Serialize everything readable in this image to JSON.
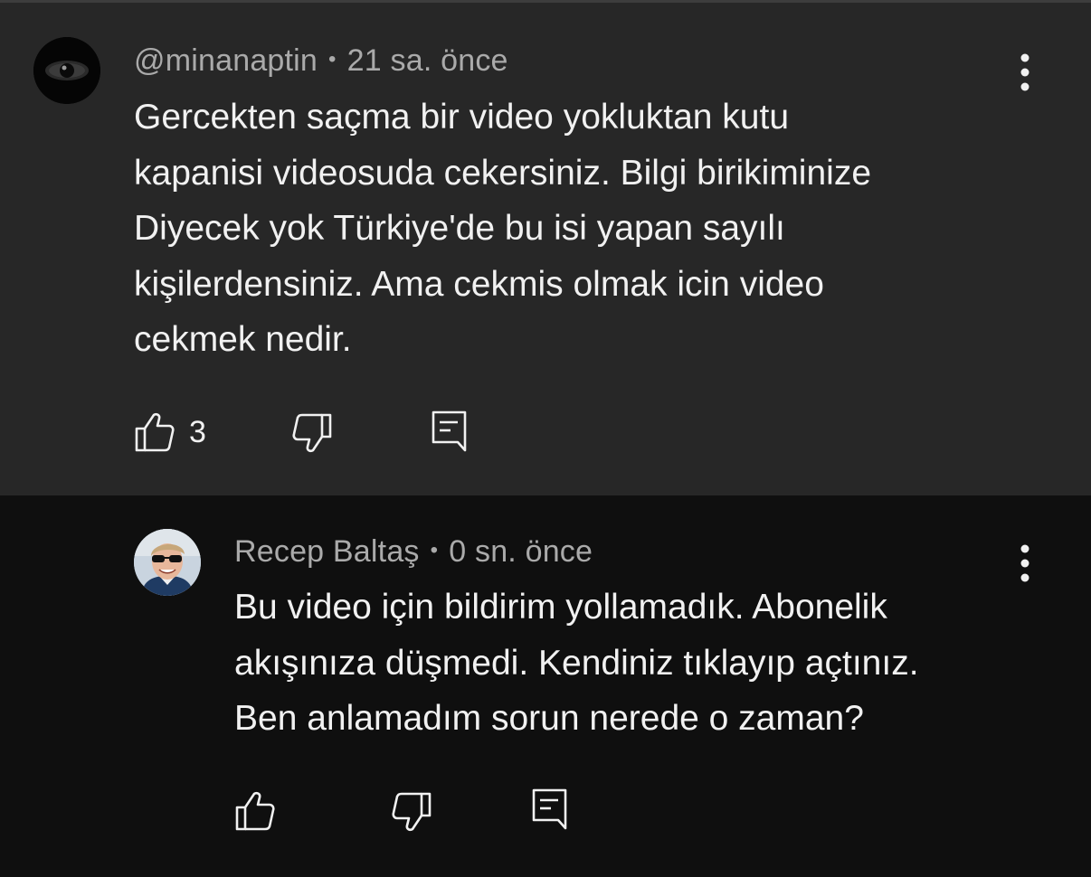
{
  "comments": [
    {
      "username": "@minanaptin",
      "separator": "•",
      "time": "21 sa. önce",
      "lines": [
        "Gercekten saçma bir video yokluktan kutu",
        "kapanisi videosuda cekersiniz. Bilgi birikiminize",
        "Diyecek yok Türkiye'de bu isi yapan sayılı",
        "kişilerdensiniz. Ama cekmis olmak icin video",
        "cekmek nedir."
      ],
      "like_count": "3",
      "avatar_icon": "dark-eye-icon"
    },
    {
      "username": "Recep Baltaş",
      "separator": "•",
      "time": "0 sn. önce",
      "lines": [
        "Bu video için bildirim yollamadık. Abonelik",
        "akışınıza düşmedi. Kendiniz tıklayıp açtınız.",
        "Ben anlamadım sorun nerede o zaman?"
      ],
      "avatar_icon": "person-with-sunglasses-photo"
    }
  ],
  "colors": {
    "highlighted_bg": "#272727",
    "page_bg": "#0f0f0f",
    "text_primary": "#f1f1f1",
    "text_secondary": "#aaaaaa"
  }
}
